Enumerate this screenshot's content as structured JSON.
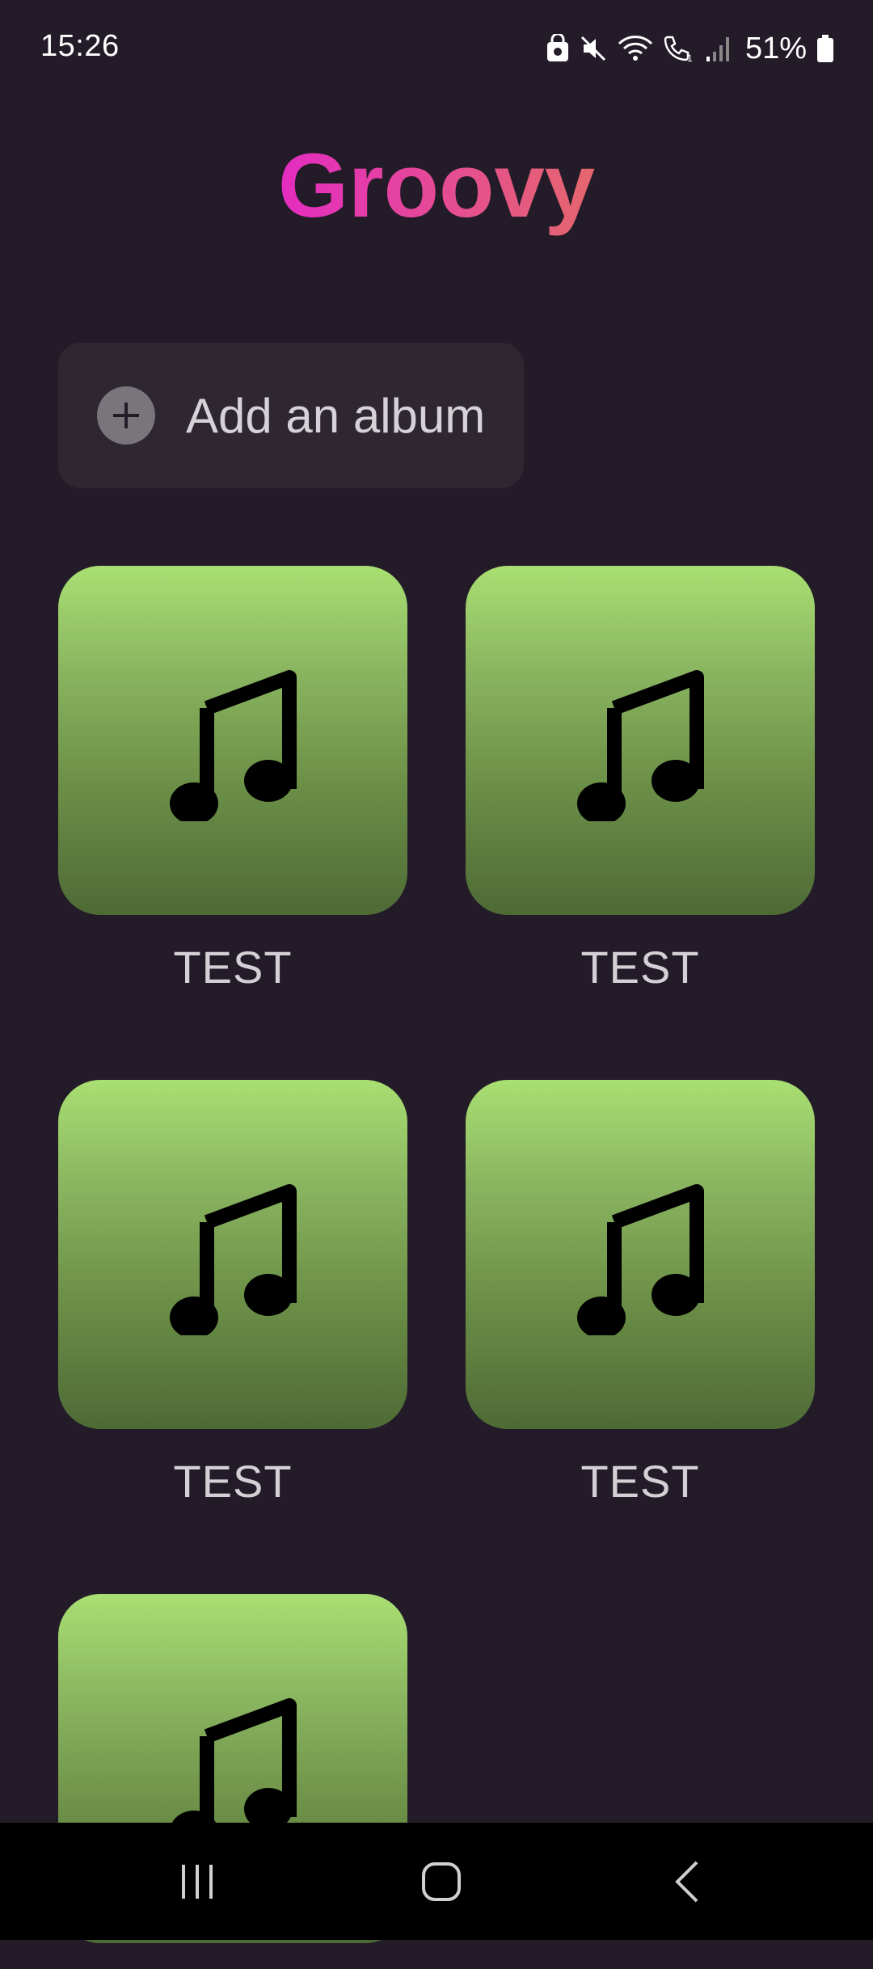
{
  "status_bar": {
    "time": "15:26",
    "battery": "51%",
    "icons": [
      "lock-screen-icon",
      "mute-icon",
      "wifi-icon",
      "wifi-calling-icon",
      "signal-icon",
      "battery-icon"
    ]
  },
  "header": {
    "title": "Groovy"
  },
  "add_album": {
    "label": "Add an album",
    "icon": "plus-icon"
  },
  "albums": [
    {
      "title": "TEST",
      "icon": "music-note-icon"
    },
    {
      "title": "TEST",
      "icon": "music-note-icon"
    },
    {
      "title": "TEST",
      "icon": "music-note-icon"
    },
    {
      "title": "TEST",
      "icon": "music-note-icon"
    },
    {
      "title": "",
      "icon": "music-note-icon"
    }
  ],
  "colors": {
    "background": "#231c28",
    "title_gradient_start": "#e42cc1",
    "title_gradient_end": "#e5676d",
    "cover_top": "#a9df72",
    "cover_bottom": "#4e6a35",
    "add_button_bg": "#2e2631"
  },
  "nav_bar": {
    "items": [
      "recent-apps-icon",
      "home-icon",
      "back-icon"
    ]
  }
}
